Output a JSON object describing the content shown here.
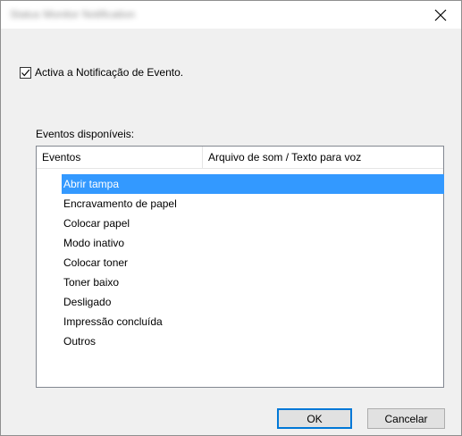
{
  "window": {
    "title": "Status Monitor Notification"
  },
  "options": {
    "enable_label": "Activa a Notificação de Evento.",
    "enable_checked": true
  },
  "events": {
    "group_label": "Eventos disponíveis:",
    "columns": [
      "Eventos",
      "Arquivo de som / Texto para voz"
    ],
    "rows": [
      {
        "event": "Abrir tampa",
        "selected": true
      },
      {
        "event": "Encravamento de papel"
      },
      {
        "event": "Colocar papel"
      },
      {
        "event": "Modo inativo"
      },
      {
        "event": "Colocar toner"
      },
      {
        "event": "Toner baixo"
      },
      {
        "event": "Desligado"
      },
      {
        "event": "Impressão concluída"
      },
      {
        "event": "Outros"
      }
    ]
  },
  "buttons": {
    "ok_label": "OK",
    "cancel_label": "Cancelar"
  },
  "icons": {
    "close": "close-icon",
    "check": "check-icon"
  },
  "colors": {
    "selection": "#3399ff",
    "default_button_border": "#0078d7",
    "dialog_background": "#f0f0f0"
  }
}
